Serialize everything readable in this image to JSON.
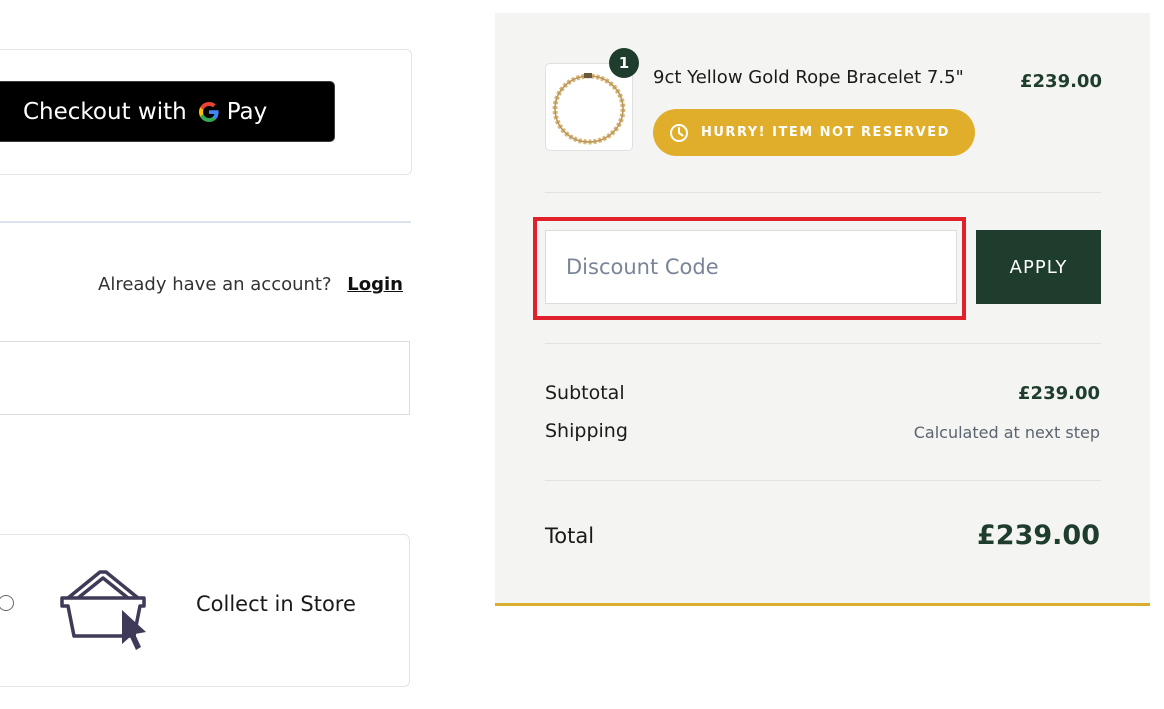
{
  "express_checkout": {
    "gpay_label": "Checkout with",
    "gpay_suffix": "Pay"
  },
  "account": {
    "prompt": "Already have an account?",
    "login_link": "Login"
  },
  "delivery_options": [
    {
      "label": "Collect in Store",
      "icon": "basket-cursor-icon"
    }
  ],
  "order_summary": {
    "item": {
      "quantity": "1",
      "name": "9ct Yellow Gold Rope Bracelet 7.5\"",
      "price": "£239.00",
      "badge": "HURRY! ITEM NOT RESERVED"
    },
    "discount": {
      "placeholder": "Discount Code",
      "apply_label": "APPLY"
    },
    "subtotal_label": "Subtotal",
    "subtotal_value": "£239.00",
    "shipping_label": "Shipping",
    "shipping_value": "Calculated at next step",
    "total_label": "Total",
    "total_value": "£239.00"
  },
  "colors": {
    "brand_green": "#1e3d2c",
    "badge_gold": "#e0ae2a",
    "highlight_red": "#e0212b",
    "summary_bg": "#f4f4f2"
  }
}
